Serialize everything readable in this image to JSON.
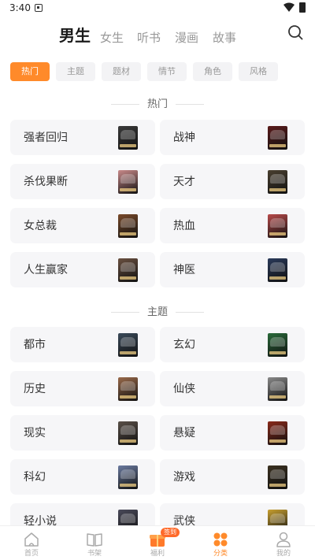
{
  "status_bar": {
    "time": "3:40"
  },
  "top_tabs": [
    {
      "label": "男生",
      "active": true
    },
    {
      "label": "女生",
      "active": false
    },
    {
      "label": "听书",
      "active": false
    },
    {
      "label": "漫画",
      "active": false
    },
    {
      "label": "故事",
      "active": false
    }
  ],
  "filter_chips": [
    {
      "label": "热门",
      "active": true
    },
    {
      "label": "主题",
      "active": false
    },
    {
      "label": "题材",
      "active": false
    },
    {
      "label": "情节",
      "active": false
    },
    {
      "label": "角色",
      "active": false
    },
    {
      "label": "风格",
      "active": false
    }
  ],
  "sections": [
    {
      "title": "热门",
      "items": [
        {
          "label": "强者回归",
          "cover_color": "#3a3a3a"
        },
        {
          "label": "战神",
          "cover_color": "#5a1a1a"
        },
        {
          "label": "杀伐果断",
          "cover_color": "#c98a8a"
        },
        {
          "label": "天才",
          "cover_color": "#4a4030"
        },
        {
          "label": "女总裁",
          "cover_color": "#7a4a2a"
        },
        {
          "label": "热血",
          "cover_color": "#b84a4a"
        },
        {
          "label": "人生赢家",
          "cover_color": "#6a5040"
        },
        {
          "label": "神医",
          "cover_color": "#2a3a5a"
        }
      ]
    },
    {
      "title": "主题",
      "items": [
        {
          "label": "都市",
          "cover_color": "#3a4a5a"
        },
        {
          "label": "玄幻",
          "cover_color": "#2a6a3a"
        },
        {
          "label": "历史",
          "cover_color": "#9a6a4a"
        },
        {
          "label": "仙侠",
          "cover_color": "#8a8a8a"
        },
        {
          "label": "现实",
          "cover_color": "#5a5048"
        },
        {
          "label": "悬疑",
          "cover_color": "#8a2a1a"
        },
        {
          "label": "科幻",
          "cover_color": "#6a7aa0"
        },
        {
          "label": "游戏",
          "cover_color": "#3a3020"
        },
        {
          "label": "轻小说",
          "cover_color": "#4a4a5a"
        },
        {
          "label": "武侠",
          "cover_color": "#c8a030"
        }
      ]
    }
  ],
  "bottom_nav": [
    {
      "label": "首页",
      "icon": "home-icon",
      "active": false
    },
    {
      "label": "书架",
      "icon": "bookshelf-icon",
      "active": false
    },
    {
      "label": "福利",
      "icon": "gift-icon",
      "active": false,
      "badge": "签到"
    },
    {
      "label": "分类",
      "icon": "category-icon",
      "active": true
    },
    {
      "label": "我的",
      "icon": "profile-icon",
      "active": false
    }
  ],
  "colors": {
    "accent": "#ff8a2a",
    "card_bg": "#f6f6f8",
    "inactive_text": "#999999"
  }
}
